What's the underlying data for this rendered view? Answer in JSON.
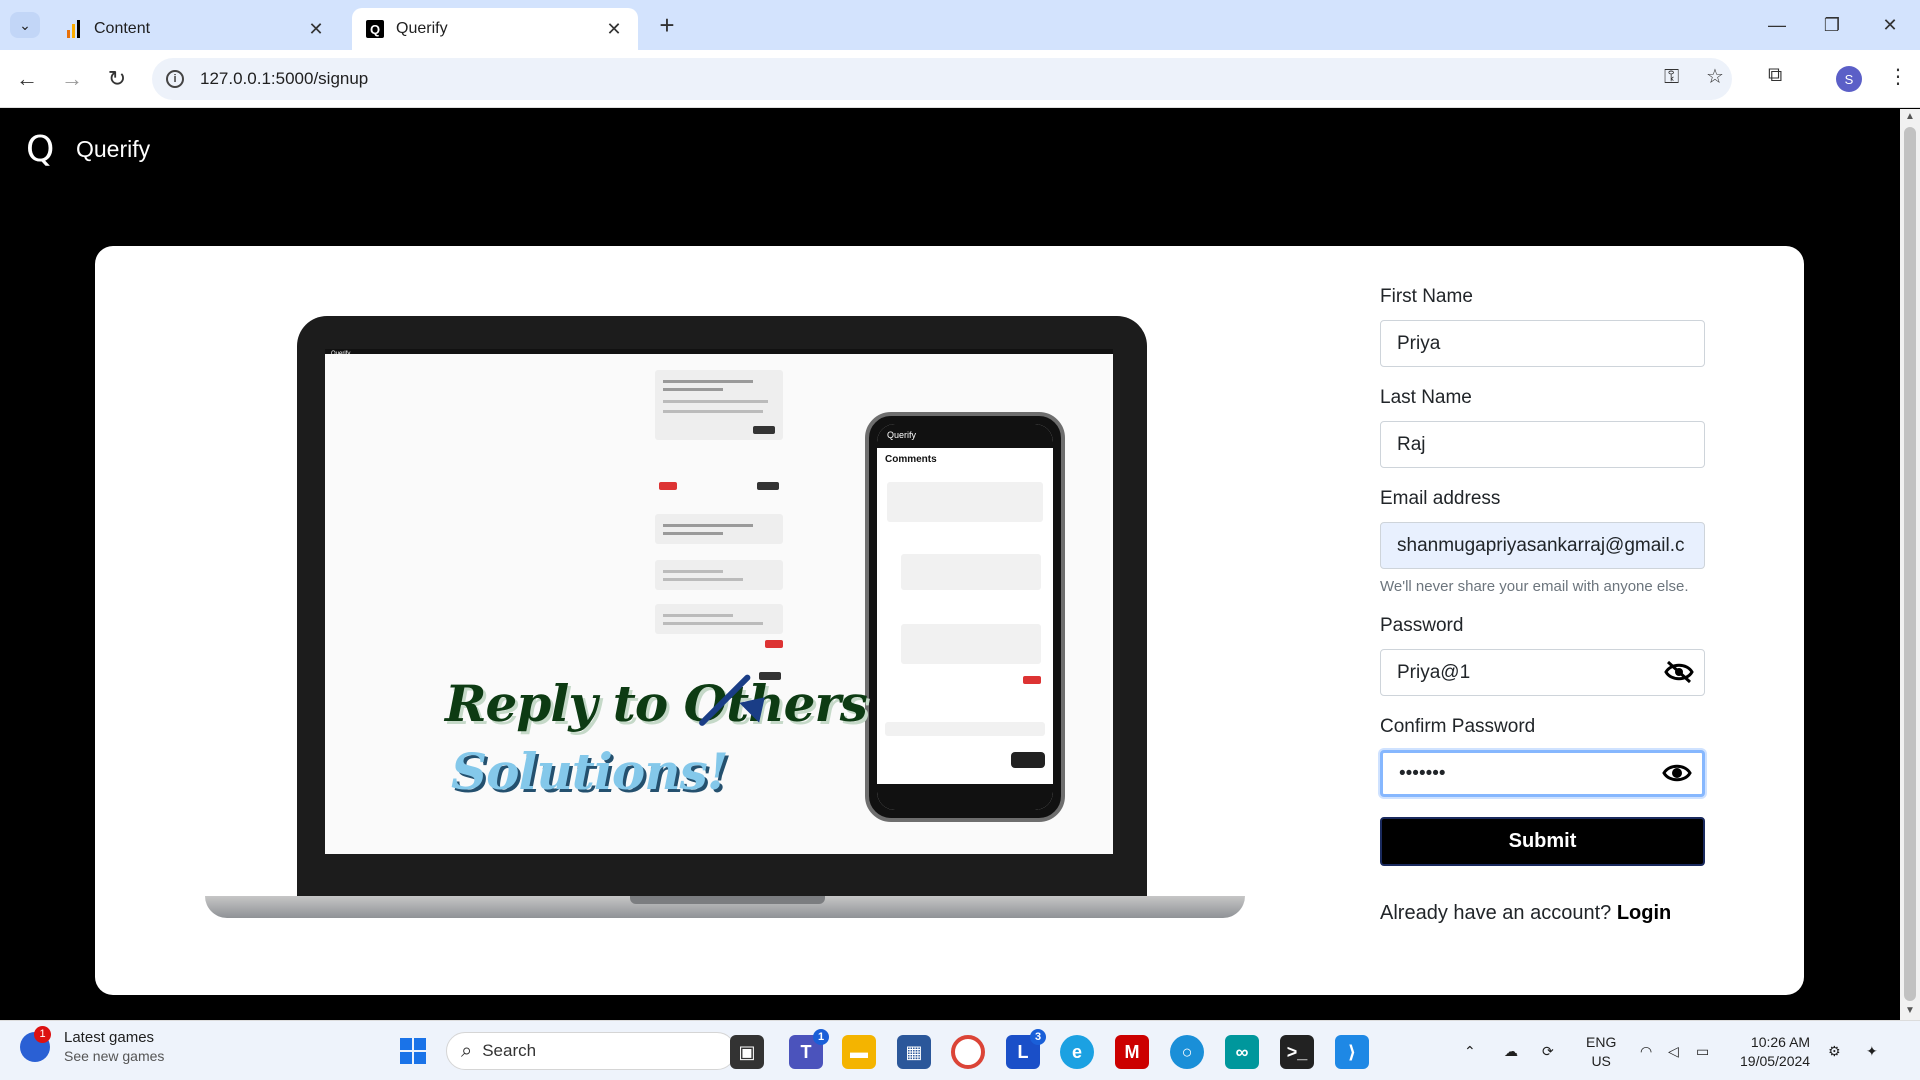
{
  "browser": {
    "tabs": [
      {
        "title": "Content",
        "active": false
      },
      {
        "title": "Querify",
        "active": true
      }
    ],
    "url": "127.0.0.1:5000/signup",
    "profile_initial": "S"
  },
  "app": {
    "brand_logo": "Q",
    "brand_name": "Querify"
  },
  "illustration": {
    "headline_line1": "Reply to Others",
    "headline_line2": "Solutions!",
    "screen_brand": "Querify",
    "phone_header": "Querify",
    "phone_section": "Comments"
  },
  "form": {
    "first_name": {
      "label": "First Name",
      "value": "Priya"
    },
    "last_name": {
      "label": "Last Name",
      "value": "Raj"
    },
    "email": {
      "label": "Email address",
      "value": "shanmugapriyasankarraj@gmail.c",
      "help": "We'll never share your email with anyone else."
    },
    "password": {
      "label": "Password",
      "value": "Priya@1",
      "icon": "eye-off-icon"
    },
    "confirm_password": {
      "label": "Confirm Password",
      "value": "•••••••",
      "icon": "eye-icon"
    },
    "submit_label": "Submit",
    "login_prompt": "Already have an account?",
    "login_link": "Login"
  },
  "taskbar": {
    "news_title": "Latest games",
    "news_subtitle": "See new games",
    "news_badge": "1",
    "search_placeholder": "Search",
    "teams_badge": "1",
    "l_badge": "3",
    "lang_top": "ENG",
    "lang_bottom": "US",
    "time": "10:26 AM",
    "date": "19/05/2024"
  }
}
